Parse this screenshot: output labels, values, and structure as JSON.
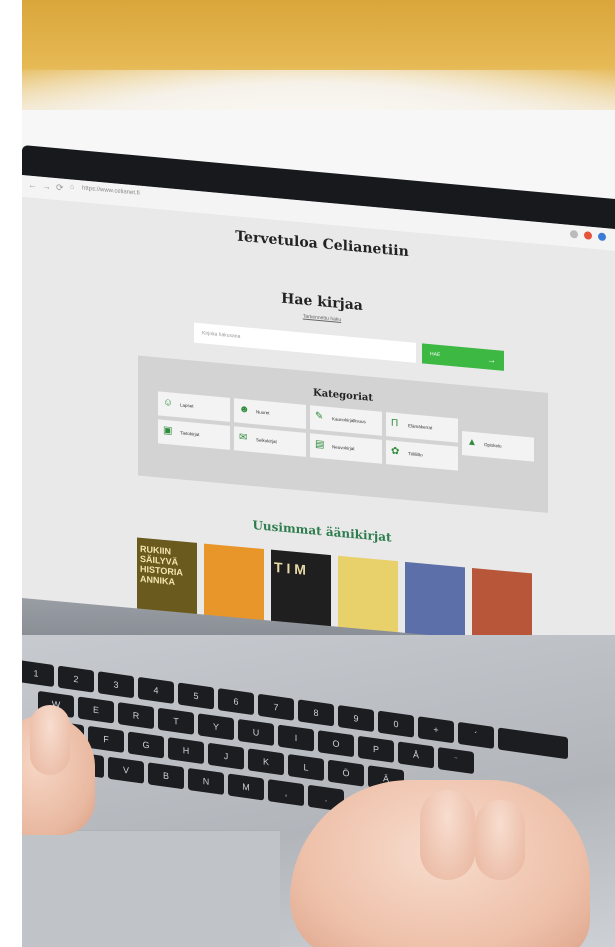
{
  "browser": {
    "url": "https://www.celianet.fi"
  },
  "site": {
    "title": "Tervetuloa Celianetiin"
  },
  "search": {
    "heading": "Hae kirjaa",
    "subtitle": "Tarkennettu haku",
    "placeholder": "Kirjoita hakusana",
    "button_label": "HAE"
  },
  "categories": {
    "heading": "Kategoriat",
    "items": [
      {
        "label": "Lapset",
        "icon": "child-icon"
      },
      {
        "label": "Nuoret",
        "icon": "teen-icon"
      },
      {
        "label": "Kaunokirjallisuus",
        "icon": "quill-icon"
      },
      {
        "label": "Elämäkerrat",
        "icon": "pillar-icon"
      },
      {
        "label": "Opiskelu",
        "icon": "graduation-cap-icon"
      },
      {
        "label": "Tietokirjat",
        "icon": "book-icon"
      },
      {
        "label": "Selkokirjat",
        "icon": "easy-read-icon"
      },
      {
        "label": "Neuvokirjat",
        "icon": "notebook-icon"
      },
      {
        "label": "Tiililiitto",
        "icon": "gift-icon"
      }
    ]
  },
  "new_audiobooks": {
    "heading": "Uusimmat äänikirjat",
    "covers": [
      {
        "title": "RUKIIN SÄILYVÄ HISTORIA ANNIKA",
        "color": "#6b5a1e"
      },
      {
        "title": "",
        "color": "#e8952a"
      },
      {
        "title": "T I M",
        "color": "#1f1f1f"
      },
      {
        "title": "",
        "color": "#e8d06a"
      },
      {
        "title": "",
        "color": "#5d6fa8"
      },
      {
        "title": "",
        "color": "#b8563a"
      }
    ]
  },
  "colors": {
    "accent_green": "#3db843",
    "heading_green": "#2e7d4f"
  }
}
